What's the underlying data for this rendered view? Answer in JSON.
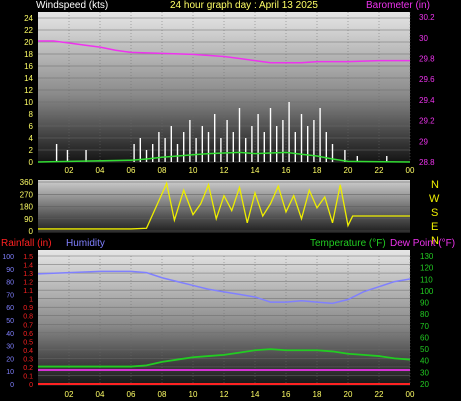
{
  "header": {
    "left_label": "Windspeed (kts)",
    "center_label": "24 hour graph day : April 13 2025",
    "right_label": "Barometer (in)"
  },
  "colors": {
    "wind": "#ffffff",
    "gust": "#33dd33",
    "barometer": "#ee33ee",
    "direction": "#eeee00",
    "rain": "#ff2222",
    "humidity": "#8080ff",
    "temperature": "#22cc22",
    "dewpoint": "#ee33ee",
    "axis_left": "#ffff66",
    "axis_right_pink": "#ee33ee",
    "axis_right_green": "#22cc22"
  },
  "panel3": {
    "rain_label": "Rainfall (in)",
    "humidity_label": "Humidity",
    "temp_label": "Temperature (°F)",
    "dew_label": "Dew Point (°F)"
  },
  "compass": [
    "N",
    "W",
    "S",
    "E",
    "N"
  ],
  "chart_data": [
    {
      "type": "line",
      "title": "24 hour graph day : April 13 2025",
      "x_ticks": [
        "02",
        "04",
        "06",
        "08",
        "10",
        "12",
        "14",
        "16",
        "18",
        "20",
        "22",
        "00"
      ],
      "xlim": [
        0,
        24
      ],
      "y_left": {
        "label": "Windspeed (kts)",
        "ticks": [
          0,
          2,
          4,
          6,
          8,
          10,
          12,
          14,
          16,
          18,
          20,
          22,
          24
        ],
        "ylim": [
          0,
          25
        ]
      },
      "y_right": {
        "label": "Barometer (in)",
        "ticks": [
          "28.8",
          "29",
          "29.2",
          "29.4",
          "29.6",
          "29.8",
          "30",
          "30.2"
        ],
        "ylim": [
          28.8,
          30.25
        ]
      },
      "series": [
        {
          "name": "Barometer (in)",
          "x": [
            0,
            1,
            2,
            3,
            4,
            5,
            6,
            8,
            10,
            12,
            13,
            14,
            15,
            16,
            17,
            18,
            19,
            20,
            22,
            24
          ],
          "values": [
            29.97,
            29.97,
            29.95,
            29.93,
            29.91,
            29.88,
            29.86,
            29.85,
            29.84,
            29.82,
            29.8,
            29.78,
            29.76,
            29.76,
            29.76,
            29.77,
            29.77,
            29.77,
            29.78,
            29.78
          ]
        }
      ],
      "wind": {
        "x": [
          1.2,
          1.9,
          3.1,
          6.2,
          6.6,
          7.0,
          7.4,
          7.8,
          8.2,
          8.6,
          9.0,
          9.4,
          9.8,
          10.2,
          10.6,
          11.0,
          11.4,
          11.8,
          12.2,
          12.6,
          13.0,
          13.4,
          13.8,
          14.2,
          14.6,
          15.0,
          15.4,
          15.8,
          16.2,
          16.6,
          17.0,
          17.4,
          17.8,
          18.2,
          18.6,
          19.0,
          19.8,
          20.6,
          22.5
        ],
        "values": [
          3,
          2,
          2,
          3,
          4,
          2,
          3,
          5,
          4,
          6,
          3,
          5,
          7,
          4,
          6,
          5,
          8,
          4,
          7,
          5,
          9,
          4,
          6,
          8,
          5,
          9,
          6,
          7,
          10,
          5,
          8,
          6,
          7,
          9,
          5,
          3,
          2,
          1,
          1
        ]
      },
      "gust": {
        "x": [
          0,
          6,
          7,
          8,
          9,
          10,
          11,
          12,
          13,
          14,
          15,
          16,
          17,
          18,
          19,
          20,
          24
        ],
        "values": [
          0,
          0.3,
          0.5,
          0.8,
          1,
          1.2,
          1.4,
          1.5,
          1.6,
          1.4,
          1.5,
          1.6,
          1.3,
          1.0,
          0.5,
          0.1,
          0
        ]
      }
    },
    {
      "type": "line",
      "x_ticks": [],
      "xlim": [
        0,
        24
      ],
      "y_left": {
        "ticks": [
          0,
          90,
          180,
          270,
          360
        ],
        "ylim": [
          0,
          360
        ]
      },
      "series": [
        {
          "name": "Wind direction",
          "x": [
            0,
            6,
            7,
            8.3,
            8.8,
            9.4,
            10,
            10.5,
            11,
            11.5,
            12,
            12.5,
            13,
            13.5,
            14,
            14.5,
            15,
            15.5,
            16,
            16.5,
            17,
            17.5,
            18,
            18.5,
            19,
            19.5,
            20,
            20.3,
            24
          ],
          "values": [
            15,
            15,
            20,
            350,
            80,
            300,
            120,
            200,
            340,
            90,
            260,
            150,
            320,
            60,
            280,
            110,
            200,
            330,
            140,
            260,
            90,
            300,
            170,
            250,
            60,
            340,
            40,
            110,
            110
          ]
        }
      ]
    },
    {
      "type": "line",
      "x_ticks": [
        "02",
        "04",
        "06",
        "08",
        "10",
        "12",
        "14",
        "16",
        "18",
        "20",
        "22",
        "00"
      ],
      "xlim": [
        0,
        24
      ],
      "y_left": {
        "label": "Rainfall (in)",
        "ticks": [
          "0",
          "0.1",
          "0.2",
          "0.3",
          "0.4",
          "0.5",
          "0.6",
          "0.7",
          "0.8",
          "0.9",
          "1",
          "1.1",
          "1.2",
          "1.3",
          "1.4",
          "1.5"
        ],
        "ylim": [
          0,
          1.5
        ]
      },
      "y_left2": {
        "label": "Humidity",
        "ticks": [
          0,
          10,
          20,
          30,
          40,
          50,
          60,
          70,
          80,
          90,
          100
        ],
        "ylim": [
          0,
          100
        ]
      },
      "y_right": {
        "label": "Temperature (°F)",
        "ticks": [
          20,
          30,
          40,
          50,
          60,
          70,
          80,
          90,
          100,
          110,
          120,
          130
        ],
        "ylim": [
          20,
          130
        ]
      },
      "series": [
        {
          "name": "Humidity",
          "x": [
            0,
            2,
            4,
            6,
            7,
            8,
            9,
            10,
            11,
            12,
            13,
            14,
            15,
            16,
            17,
            18,
            19,
            20,
            21,
            22,
            23,
            24
          ],
          "values": [
            86,
            87,
            88,
            88,
            87,
            83,
            80,
            77,
            74,
            72,
            70,
            68,
            64,
            64,
            65,
            64,
            63,
            66,
            72,
            76,
            80,
            82
          ]
        },
        {
          "name": "Temperature (°F)",
          "x": [
            0,
            2,
            4,
            6,
            7,
            8,
            9,
            10,
            11,
            12,
            13,
            14,
            15,
            16,
            17,
            18,
            19,
            20,
            21,
            22,
            23,
            24
          ],
          "values": [
            35,
            35,
            35,
            35,
            36,
            39,
            41,
            43,
            44,
            45,
            47,
            49,
            50,
            49,
            49,
            49,
            48,
            46,
            45,
            44,
            42,
            41
          ]
        },
        {
          "name": "Dew Point (°F)",
          "x": [
            0,
            4,
            8,
            12,
            16,
            20,
            24
          ],
          "values": [
            32,
            32,
            32,
            32,
            32,
            32,
            32
          ]
        },
        {
          "name": "Rainfall (in)",
          "x": [
            0,
            24
          ],
          "values": [
            0,
            0
          ]
        }
      ]
    }
  ]
}
